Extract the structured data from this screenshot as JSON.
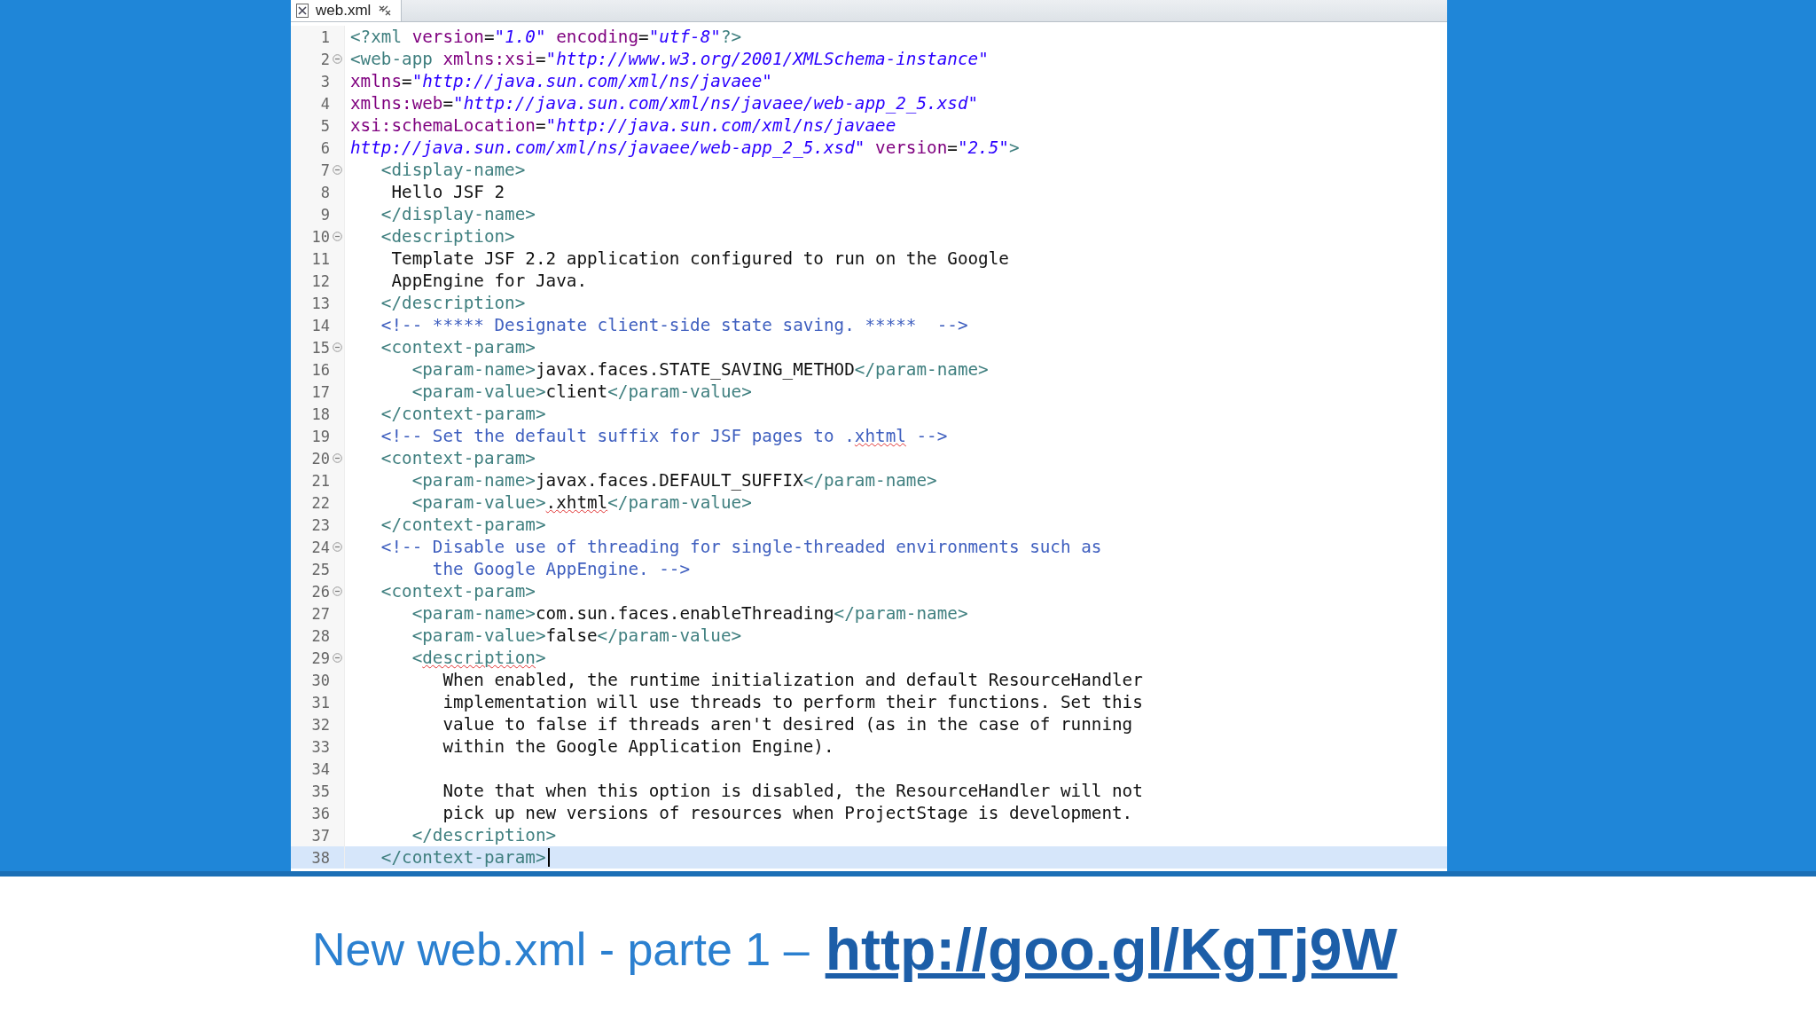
{
  "tab": {
    "label": "web.xml",
    "selected": true
  },
  "lines": [
    {
      "n": "1",
      "fold": false,
      "current": false,
      "tokens": [
        {
          "kind": "tag",
          "text": "<?xml"
        },
        {
          "kind": "attr",
          "text": " version"
        },
        {
          "kind": "text",
          "text": "="
        },
        {
          "kind": "value",
          "text": "\"1.0\""
        },
        {
          "kind": "attr",
          "text": " encoding"
        },
        {
          "kind": "text",
          "text": "="
        },
        {
          "kind": "value",
          "text": "\"utf-8\""
        },
        {
          "kind": "tag",
          "text": "?>"
        }
      ]
    },
    {
      "n": "2",
      "fold": true,
      "current": false,
      "tokens": [
        {
          "kind": "tag",
          "text": "<web-app"
        },
        {
          "kind": "attr",
          "text": " xmlns:xsi"
        },
        {
          "kind": "text",
          "text": "="
        },
        {
          "kind": "value",
          "text": "\"http://www.w3.org/2001/XMLSchema-instance\""
        }
      ]
    },
    {
      "n": "3",
      "fold": false,
      "current": false,
      "tokens": [
        {
          "kind": "attr",
          "text": "xmlns"
        },
        {
          "kind": "text",
          "text": "="
        },
        {
          "kind": "value",
          "text": "\"http://java.sun.com/xml/ns/javaee\""
        }
      ]
    },
    {
      "n": "4",
      "fold": false,
      "current": false,
      "tokens": [
        {
          "kind": "attr",
          "text": "xmlns:web"
        },
        {
          "kind": "text",
          "text": "="
        },
        {
          "kind": "value",
          "text": "\"http://java.sun.com/xml/ns/javaee/web-app_2_5.xsd\""
        }
      ]
    },
    {
      "n": "5",
      "fold": false,
      "current": false,
      "tokens": [
        {
          "kind": "attr",
          "text": "xsi:schemaLocation"
        },
        {
          "kind": "text",
          "text": "="
        },
        {
          "kind": "value",
          "text": "\"http://java.sun.com/xml/ns/javaee"
        }
      ]
    },
    {
      "n": "6",
      "fold": false,
      "current": false,
      "tokens": [
        {
          "kind": "value",
          "text": "http://java.sun.com/xml/ns/javaee/web-app_2_5.xsd\""
        },
        {
          "kind": "attr",
          "text": " version"
        },
        {
          "kind": "text",
          "text": "="
        },
        {
          "kind": "value",
          "text": "\"2.5\""
        },
        {
          "kind": "tag",
          "text": ">"
        }
      ]
    },
    {
      "n": "7",
      "fold": true,
      "current": false,
      "tokens": [
        {
          "kind": "tag",
          "text": "   <display-name>"
        }
      ]
    },
    {
      "n": "8",
      "fold": false,
      "current": false,
      "tokens": [
        {
          "kind": "text",
          "text": "    Hello JSF 2"
        }
      ]
    },
    {
      "n": "9",
      "fold": false,
      "current": false,
      "tokens": [
        {
          "kind": "tag",
          "text": "   </display-name>"
        }
      ]
    },
    {
      "n": "10",
      "fold": true,
      "current": false,
      "tokens": [
        {
          "kind": "tag",
          "text": "   <description>"
        }
      ]
    },
    {
      "n": "11",
      "fold": false,
      "current": false,
      "tokens": [
        {
          "kind": "text",
          "text": "    Template JSF 2.2 application configured to run on the Google"
        }
      ]
    },
    {
      "n": "12",
      "fold": false,
      "current": false,
      "tokens": [
        {
          "kind": "text",
          "text": "    AppEngine for Java."
        }
      ]
    },
    {
      "n": "13",
      "fold": false,
      "current": false,
      "tokens": [
        {
          "kind": "tag",
          "text": "   </description>"
        }
      ]
    },
    {
      "n": "14",
      "fold": false,
      "current": false,
      "tokens": [
        {
          "kind": "comment",
          "text": "   <!-- ***** Designate client-side state saving. *****  -->"
        }
      ]
    },
    {
      "n": "15",
      "fold": true,
      "current": false,
      "tokens": [
        {
          "kind": "tag",
          "text": "   <context-param>"
        }
      ]
    },
    {
      "n": "16",
      "fold": false,
      "current": false,
      "tokens": [
        {
          "kind": "tag",
          "text": "      <param-name>"
        },
        {
          "kind": "text",
          "text": "javax.faces.STATE_SAVING_METHOD"
        },
        {
          "kind": "tag",
          "text": "</param-name>"
        }
      ]
    },
    {
      "n": "17",
      "fold": false,
      "current": false,
      "tokens": [
        {
          "kind": "tag",
          "text": "      <param-value>"
        },
        {
          "kind": "text",
          "text": "client"
        },
        {
          "kind": "tag",
          "text": "</param-value>"
        }
      ]
    },
    {
      "n": "18",
      "fold": false,
      "current": false,
      "tokens": [
        {
          "kind": "tag",
          "text": "   </context-param>"
        }
      ]
    },
    {
      "n": "19",
      "fold": false,
      "current": false,
      "tokens": [
        {
          "kind": "comment",
          "text": "   <!-- Set the default suffix for JSF pages to ."
        },
        {
          "kind": "comment_typo",
          "text": "xhtml"
        },
        {
          "kind": "comment",
          "text": " -->"
        }
      ]
    },
    {
      "n": "20",
      "fold": true,
      "current": false,
      "tokens": [
        {
          "kind": "tag",
          "text": "   <context-param>"
        }
      ]
    },
    {
      "n": "21",
      "fold": false,
      "current": false,
      "tokens": [
        {
          "kind": "tag",
          "text": "      <param-name>"
        },
        {
          "kind": "text",
          "text": "javax.faces.DEFAULT_SUFFIX"
        },
        {
          "kind": "tag",
          "text": "</param-name>"
        }
      ]
    },
    {
      "n": "22",
      "fold": false,
      "current": false,
      "tokens": [
        {
          "kind": "tag",
          "text": "      <param-value>"
        },
        {
          "kind": "text_typo",
          "text": ".xhtml"
        },
        {
          "kind": "tag",
          "text": "</param-value>"
        }
      ]
    },
    {
      "n": "23",
      "fold": false,
      "current": false,
      "tokens": [
        {
          "kind": "tag",
          "text": "   </context-param>"
        }
      ]
    },
    {
      "n": "24",
      "fold": true,
      "current": false,
      "tokens": [
        {
          "kind": "comment",
          "text": "   <!-- Disable use of threading for single-threaded environments such as"
        }
      ]
    },
    {
      "n": "25",
      "fold": false,
      "current": false,
      "tokens": [
        {
          "kind": "comment",
          "text": "        the Google AppEngine. -->"
        }
      ]
    },
    {
      "n": "26",
      "fold": true,
      "current": false,
      "tokens": [
        {
          "kind": "tag",
          "text": "   <context-param>"
        }
      ]
    },
    {
      "n": "27",
      "fold": false,
      "current": false,
      "tokens": [
        {
          "kind": "tag",
          "text": "      <param-name>"
        },
        {
          "kind": "text",
          "text": "com.sun.faces.enableThreading"
        },
        {
          "kind": "tag",
          "text": "</param-name>"
        }
      ]
    },
    {
      "n": "28",
      "fold": false,
      "current": false,
      "tokens": [
        {
          "kind": "tag",
          "text": "      <param-value>"
        },
        {
          "kind": "text",
          "text": "false"
        },
        {
          "kind": "tag",
          "text": "</param-value>"
        }
      ]
    },
    {
      "n": "29",
      "fold": true,
      "current": false,
      "tokens": [
        {
          "kind": "tag",
          "text": "      <"
        },
        {
          "kind": "tag_typo",
          "text": "description"
        },
        {
          "kind": "tag",
          "text": ">"
        }
      ]
    },
    {
      "n": "30",
      "fold": false,
      "current": false,
      "tokens": [
        {
          "kind": "text",
          "text": "         When enabled, the runtime initialization and default ResourceHandler"
        }
      ]
    },
    {
      "n": "31",
      "fold": false,
      "current": false,
      "tokens": [
        {
          "kind": "text",
          "text": "         implementation will use threads to perform their functions. Set this"
        }
      ]
    },
    {
      "n": "32",
      "fold": false,
      "current": false,
      "tokens": [
        {
          "kind": "text",
          "text": "         value to false if threads aren't desired (as in the case of running"
        }
      ]
    },
    {
      "n": "33",
      "fold": false,
      "current": false,
      "tokens": [
        {
          "kind": "text",
          "text": "         within the Google Application Engine)."
        }
      ]
    },
    {
      "n": "34",
      "fold": false,
      "current": false
    },
    {
      "n": "35",
      "fold": false,
      "current": false,
      "tokens": [
        {
          "kind": "text",
          "text": "         Note that when this option is disabled, the ResourceHandler will not"
        }
      ]
    },
    {
      "n": "36",
      "fold": false,
      "current": false,
      "tokens": [
        {
          "kind": "text",
          "text": "         pick up new versions of resources when ProjectStage is development."
        }
      ]
    },
    {
      "n": "37",
      "fold": false,
      "current": false,
      "tokens": [
        {
          "kind": "tag",
          "text": "      </description>"
        }
      ]
    },
    {
      "n": "38",
      "fold": false,
      "current": true,
      "tokens": [
        {
          "kind": "tag",
          "text": "   </context-param>"
        }
      ]
    }
  ],
  "caption": {
    "text": "New web.xml - parte 1 –",
    "link": "http://goo.gl/KgTj9W"
  }
}
